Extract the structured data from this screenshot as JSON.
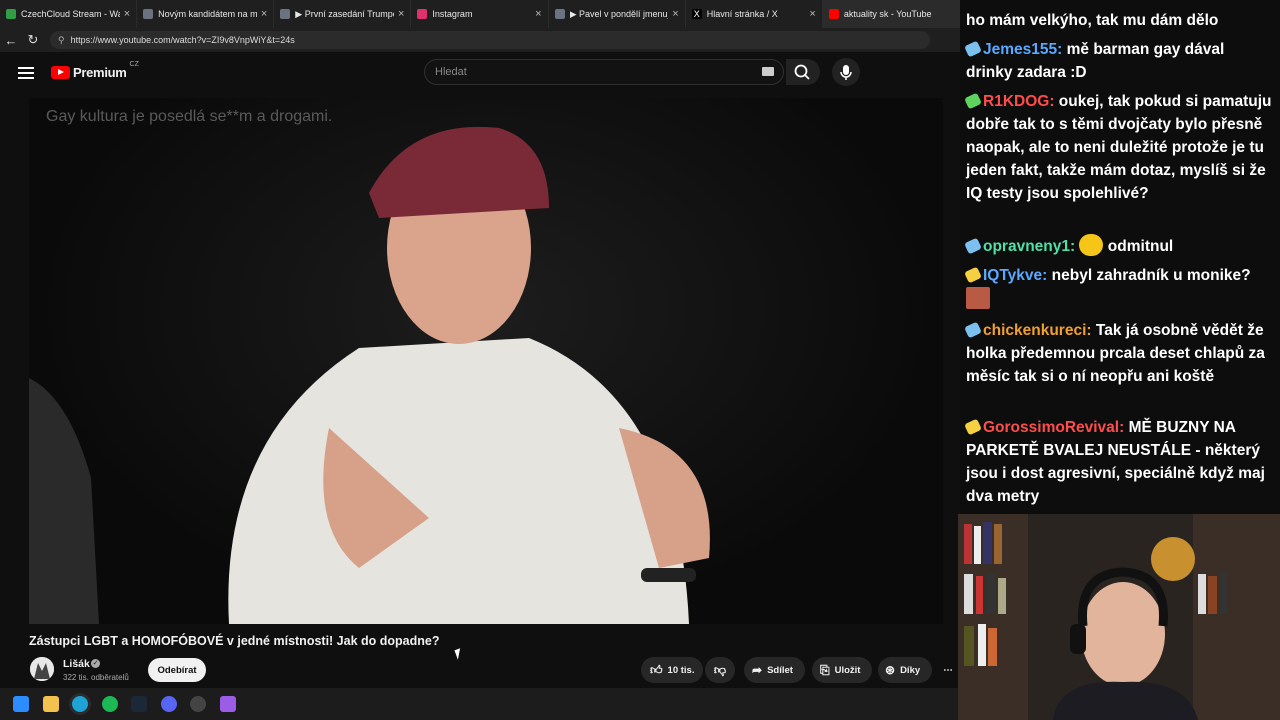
{
  "tabs": [
    {
      "title": "CzechCloud Stream - Watch I",
      "fav": "#2f9e44"
    },
    {
      "title": "Novým kandidátem na minis",
      "fav": "#6b7280"
    },
    {
      "title": "▶ První zasedání Trumpovy R",
      "fav": "#6b7280"
    },
    {
      "title": "Instagram",
      "fav": "#e1306c"
    },
    {
      "title": "▶ Pavel v pondělí jmenuje Č",
      "fav": "#6b7280"
    },
    {
      "title": "Hlavní stránka / X",
      "fav": "#000000"
    },
    {
      "title": "aktuality sk - YouTube",
      "fav": "#ff0000"
    }
  ],
  "address": {
    "url": "https://www.youtube.com/watch?v=ZI9v8VnpWiY&t=24s"
  },
  "header": {
    "logo": "Premium",
    "country": "CZ",
    "search_placeholder": "Hledat"
  },
  "video": {
    "caption": "Gay kultura je posedlá se**m a drogami.",
    "title": "Zástupci LGBT a HOMOFÓBOVÉ v jedné místnosti! Jak do dopadne?"
  },
  "channel": {
    "name": "Lišák",
    "subscribers": "322 tis. odběratelů",
    "subscribe_label": "Odebírat"
  },
  "actions": {
    "likes": "10 tis.",
    "share": "Sdílet",
    "save": "Uložit",
    "thanks": "Díky"
  },
  "chat": {
    "top_fragment": "ho mám velkýho, tak mu dám dělo",
    "messages": [
      {
        "user": "Jemes155:",
        "color": "#5aa8ff",
        "text": "mě barman gay dával drinky zadara :D"
      },
      {
        "user": "R1KDOG:",
        "color": "#ff4d4d",
        "text": "oukej, tak pokud si pamatuju dobře tak to s těmi dvojčaty bylo přesně naopak, ale to neni duležité protože je tu jeden fakt, takže mám dotaz, myslíš si že IQ testy jsou spolehlivé?"
      },
      {
        "user": "opravneny1:",
        "color": "#4fe0a8",
        "text": "odmitnul"
      },
      {
        "user": "IQTykve:",
        "color": "#5aa8ff",
        "text": "nebyl zahradník u monike?"
      },
      {
        "user": "chickenkureci:",
        "color": "#f0a030",
        "text": "Tak já osobně vědět že holka předemnou prcala deset chlapů za měsíc tak si o ní neopřu ani koště"
      },
      {
        "user": "GorossimoRevival:",
        "color": "#ff4d4d",
        "text": "MĚ BUZNY NA PARKETĚ BVALEJ NEUSTÁLE - některý jsou i dost agresivní, speciálně když maj dva metry"
      }
    ]
  },
  "colors": {
    "background": "#0f0f0f",
    "accent": "#ff0000",
    "chat_text": "#ffffff"
  }
}
